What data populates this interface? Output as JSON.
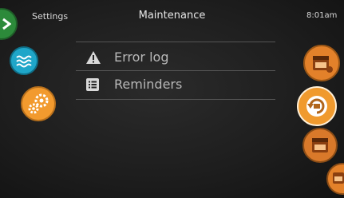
{
  "header": {
    "left_label": "Settings",
    "title": "Maintenance",
    "time": "8:01am"
  },
  "menu": {
    "items": [
      {
        "label": "Error log",
        "icon": "warning-triangle-icon"
      },
      {
        "label": "Reminders",
        "icon": "list-icon"
      }
    ]
  },
  "left_icons": [
    "water-icon",
    "gears-icon"
  ],
  "right_icons": [
    "calendar-icon",
    "refresh-icon",
    "calendar-icon",
    "calendar-icon"
  ],
  "colors": {
    "accent_orange": "#f29a2e",
    "water_blue": "#1fa6c9",
    "back_green": "#2c8a3a",
    "background": "#1e1e1e"
  }
}
